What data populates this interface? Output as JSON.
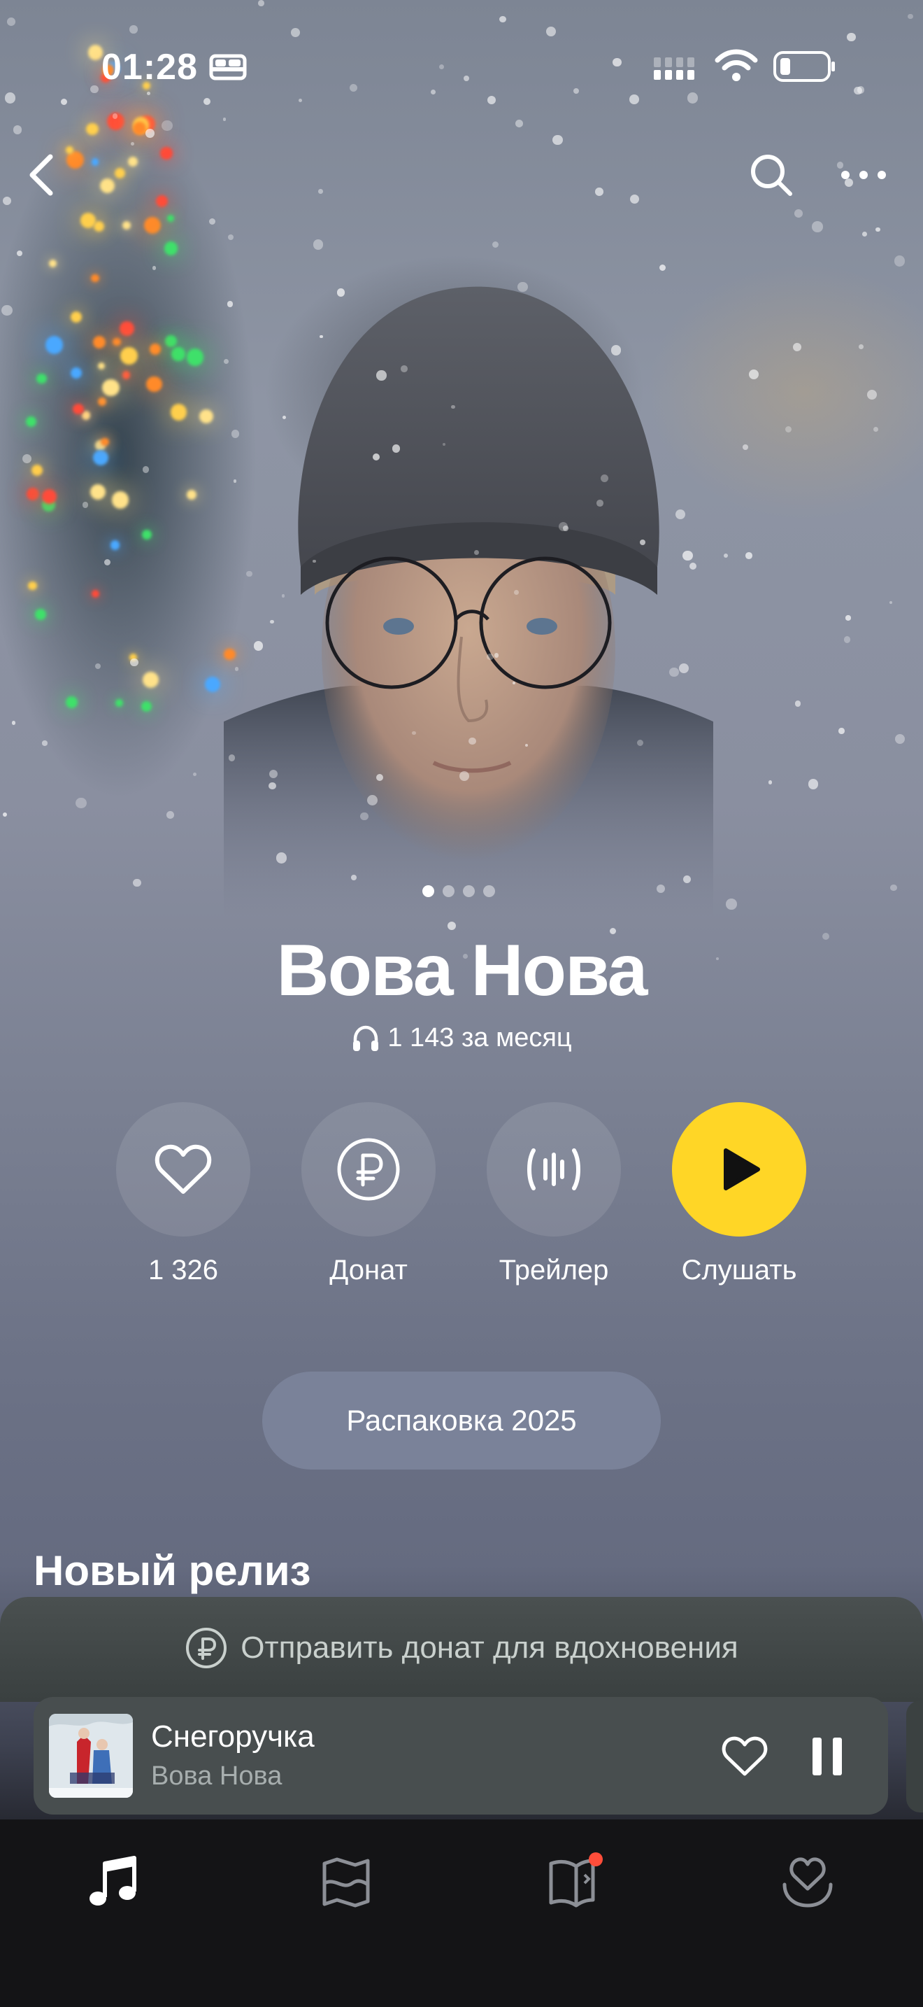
{
  "status_bar": {
    "time": "01:28"
  },
  "artist": {
    "name": "Вова Нова",
    "monthly_listeners": "1 143 за месяц"
  },
  "gallery": {
    "pages": 4,
    "active": 1
  },
  "actions": [
    {
      "icon": "heart-icon",
      "label": "1 326"
    },
    {
      "icon": "ruble-icon",
      "label": "Донат"
    },
    {
      "icon": "waveform-icon",
      "label": "Трейлер"
    },
    {
      "icon": "play-icon",
      "label": "Слушать"
    }
  ],
  "unpack_button": "Распаковка 2025",
  "section_title": "Новый релиз",
  "donate_banner": "Отправить донат для вдохновения",
  "now_playing": {
    "title": "Снегоручка",
    "artist": "Вова Нова",
    "cover_caption": "Вова Нова"
  },
  "tabbar": [
    "music-note-icon",
    "map-icon",
    "book-notification-icon",
    "heart-collection-icon"
  ],
  "colors": {
    "accent": "#ffd626",
    "notification": "#ff4d3a"
  }
}
